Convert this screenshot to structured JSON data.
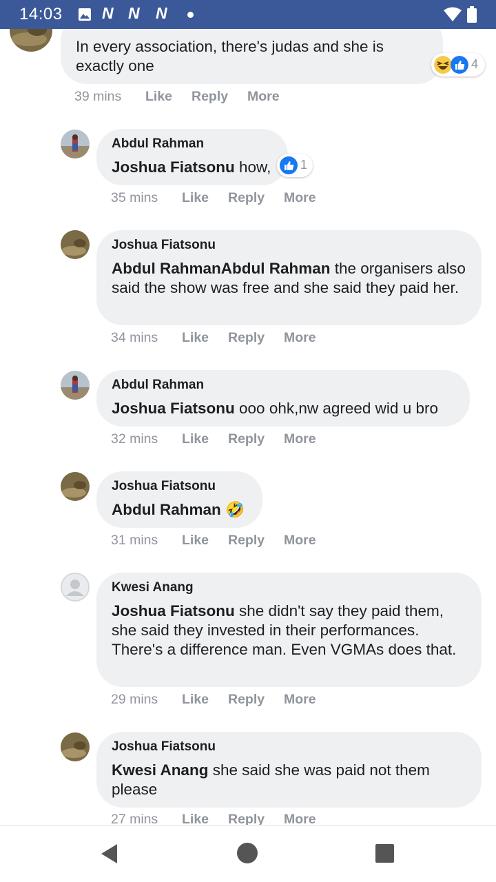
{
  "status_bar": {
    "time": "14:03",
    "notification_icons": [
      "image-icon",
      "n-icon",
      "n-icon",
      "n-icon",
      "dot-icon"
    ],
    "n_letter": "N",
    "color": "#3b5998"
  },
  "comments": [
    {
      "author": "",
      "mention": "",
      "text": "In every association, there's judas and she is exactly one",
      "time": "39 mins",
      "reactions": {
        "types": [
          "haha",
          "like"
        ],
        "count": "4"
      }
    },
    {
      "author": "Abdul Rahman",
      "mention": "Joshua Fiatsonu",
      "text": " how,",
      "time": "35 mins",
      "reactions": {
        "types": [
          "like"
        ],
        "count": "1"
      }
    },
    {
      "author": "Joshua Fiatsonu",
      "mention": "Abdul RahmanAbdul Rahman",
      "text": " the organisers also said the show was free and she said they paid her.",
      "time": "34 mins"
    },
    {
      "author": "Abdul Rahman",
      "mention": "Joshua Fiatsonu",
      "text": " ooo ohk,nw agreed wid u bro",
      "time": "32 mins"
    },
    {
      "author": "Joshua Fiatsonu",
      "mention": "Abdul Rahman",
      "text": " 🤣",
      "time": "31 mins"
    },
    {
      "author": "Kwesi Anang",
      "mention": "Joshua Fiatsonu",
      "text": " she didn't say they paid them, she said they invested in their performances. There's a difference man. Even VGMAs does that.",
      "time": "29 mins"
    },
    {
      "author": "Joshua Fiatsonu",
      "mention": "Kwesi Anang",
      "text": " she said she was paid not them please",
      "time": "27 mins"
    }
  ],
  "action_labels": {
    "like": "Like",
    "reply": "Reply",
    "more": "More"
  },
  "nav_bar": {
    "back": "back-icon",
    "home": "home-icon",
    "recents": "recents-icon"
  },
  "colors": {
    "bubble": "#eff0f2",
    "meta": "#90949c",
    "like_blue": "#1877f2"
  }
}
